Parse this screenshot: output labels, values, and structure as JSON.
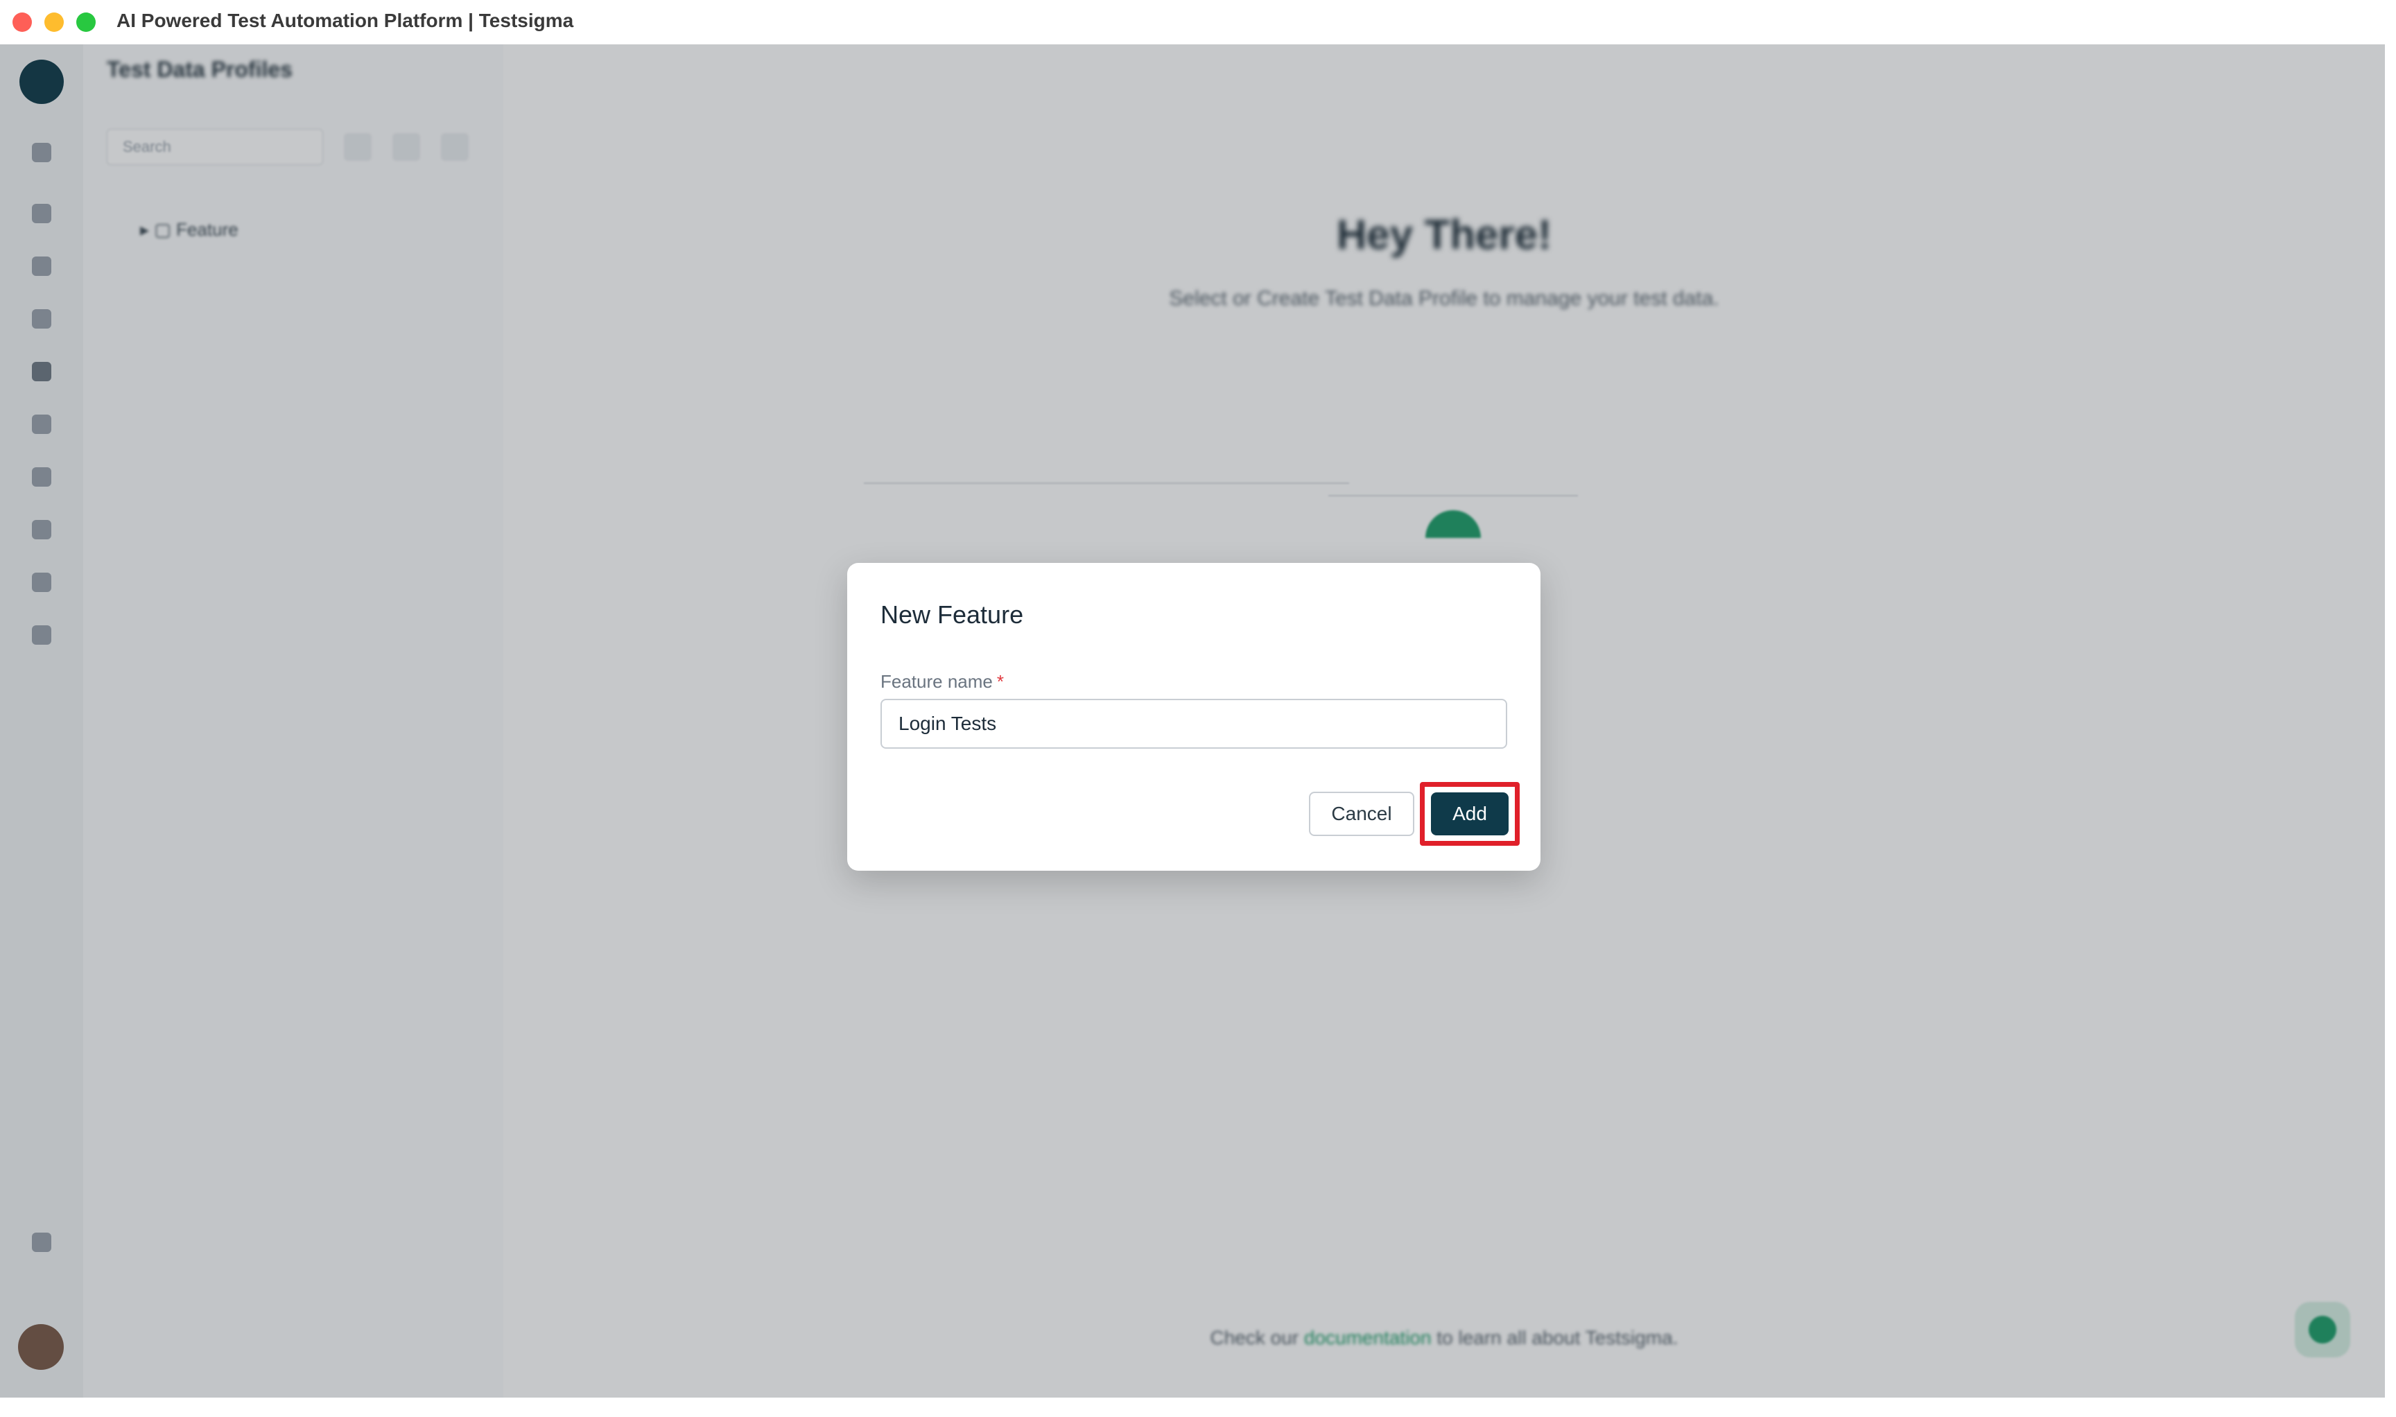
{
  "window": {
    "title": "AI Powered Test Automation Platform | Testsigma"
  },
  "sidebar_panel": {
    "title": "Test Data Profiles",
    "search_placeholder": "Search",
    "tree_item": "Feature"
  },
  "main": {
    "heading": "Hey There!",
    "subheading": "Select or Create Test Data Profile to manage your test data.",
    "footer_prefix": "Check our",
    "footer_link": "documentation",
    "footer_suffix": "to learn all about Testsigma."
  },
  "modal": {
    "title": "New Feature",
    "field_label": "Feature name",
    "required_mark": "*",
    "field_value": "Login Tests",
    "cancel_label": "Cancel",
    "add_label": "Add"
  },
  "colors": {
    "primary": "#0f3a4a",
    "accent_green": "#1e9e6a",
    "highlight_red": "#e0202a",
    "required_red": "#e0393e"
  }
}
